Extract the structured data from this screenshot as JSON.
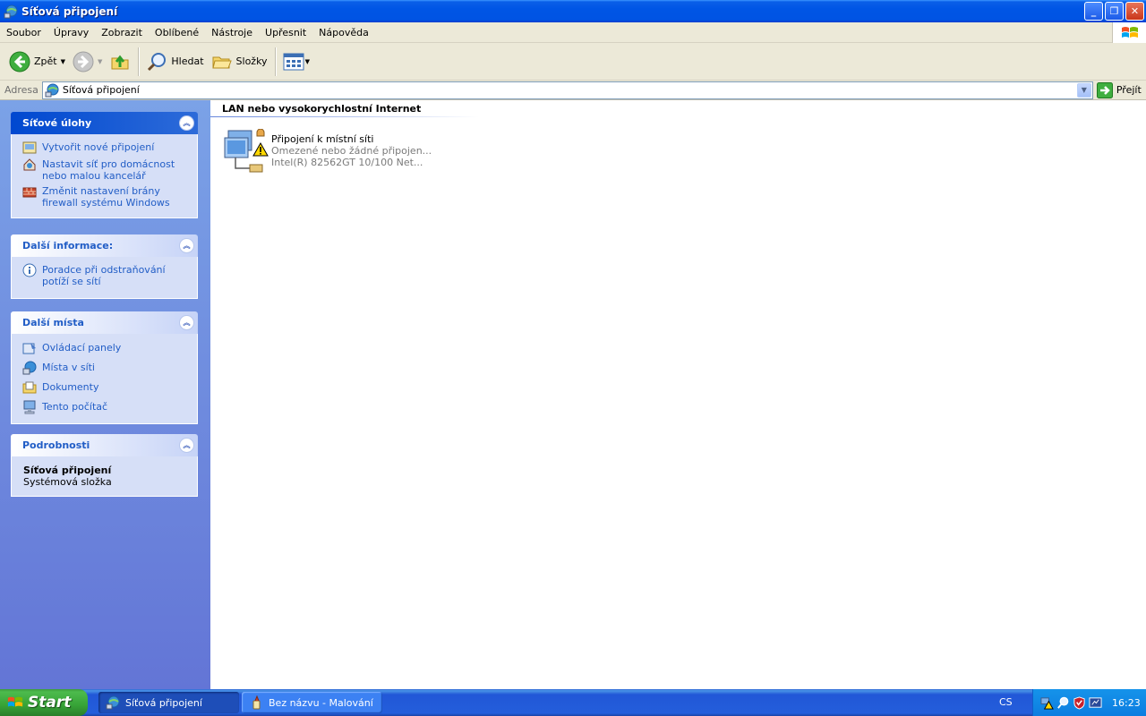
{
  "window": {
    "title": "Síťová připojení",
    "buttons": {
      "minimize": "_",
      "maximize": "❐",
      "close": "✕"
    }
  },
  "menu": [
    "Soubor",
    "Úpravy",
    "Zobrazit",
    "Oblíbené",
    "Nástroje",
    "Upřesnit",
    "Nápověda"
  ],
  "toolbar": {
    "back": "Zpět",
    "search": "Hledat",
    "folders": "Složky"
  },
  "address": {
    "label": "Adresa",
    "value": "Síťová připojení",
    "go": "Přejít"
  },
  "sidebar": {
    "panels": [
      {
        "title": "Síťové úlohy",
        "items": [
          {
            "label": "Vytvořit nové připojení",
            "icon": "new-connection-icon"
          },
          {
            "label": "Nastavit síť pro domácnost nebo malou kancelář",
            "icon": "home-network-icon"
          },
          {
            "label": "Změnit nastavení brány firewall systému Windows",
            "icon": "firewall-icon"
          }
        ]
      },
      {
        "title": "Další informace:",
        "items": [
          {
            "label": "Poradce při odstraňování potíží se sítí",
            "icon": "info-icon"
          }
        ]
      },
      {
        "title": "Další místa",
        "items": [
          {
            "label": "Ovládací panely",
            "icon": "control-panel-icon"
          },
          {
            "label": "Místa v síti",
            "icon": "network-places-icon"
          },
          {
            "label": "Dokumenty",
            "icon": "documents-icon"
          },
          {
            "label": "Tento počítač",
            "icon": "my-computer-icon"
          }
        ]
      },
      {
        "title": "Podrobnosti",
        "details_title": "Síťová připojení",
        "details_sub": "Systémová složka"
      }
    ]
  },
  "content": {
    "group_header": "LAN nebo vysokorychlostní Internet",
    "connection": {
      "name": "Připojení k místní síti",
      "status": "Omezené nebo žádné připojen...",
      "device": "Intel(R) 82562GT 10/100 Net..."
    }
  },
  "taskbar": {
    "start": "Start",
    "tasks": [
      {
        "label": "Síťová připojení",
        "active": true
      },
      {
        "label": "Bez názvu - Malování",
        "active": false
      }
    ],
    "language": "CS",
    "clock": "16:23"
  },
  "colors": {
    "titlebar": "#0054e3",
    "sidebar_top": "#7ba2e7",
    "sidebar_bottom": "#6375d6",
    "link": "#215dc6",
    "taskbar": "#245edb",
    "start": "#37a337"
  }
}
